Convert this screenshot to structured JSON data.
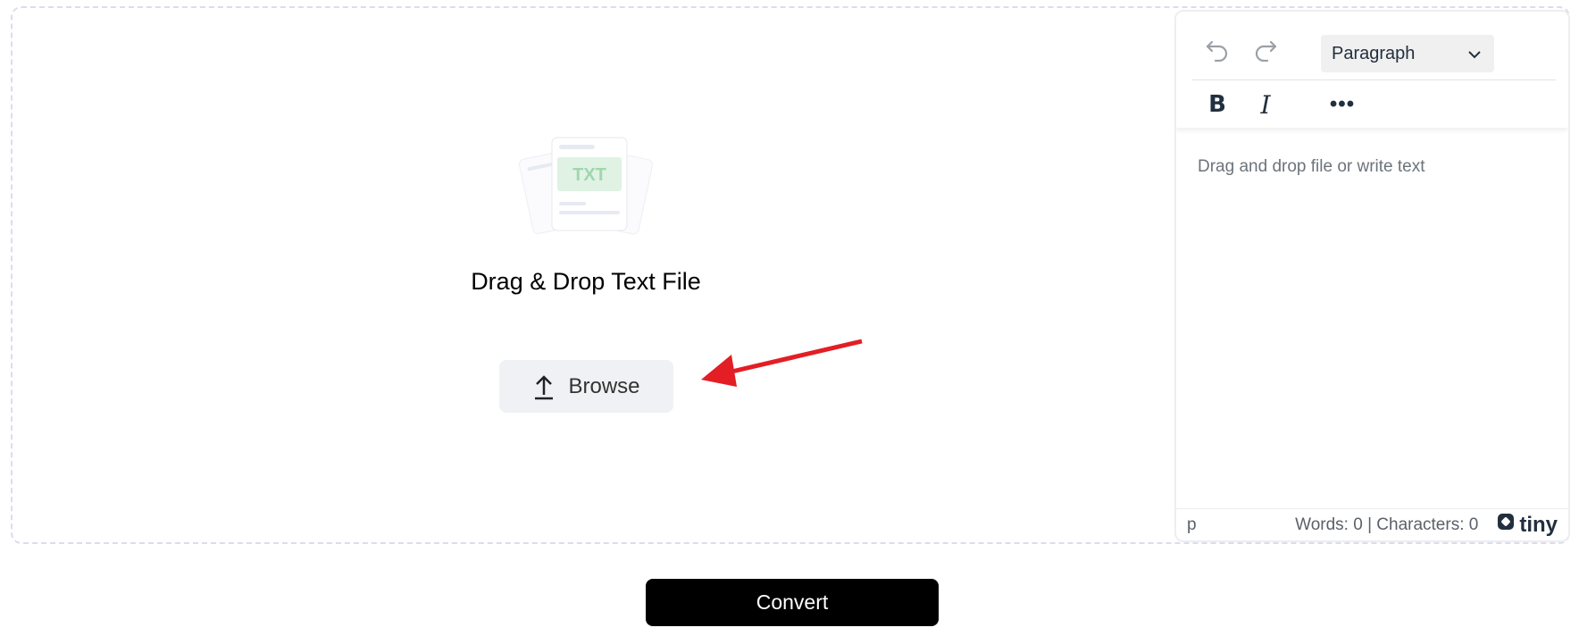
{
  "dropzone": {
    "illustration_label": "TXT",
    "title": "Drag & Drop Text File",
    "browse_label": "Browse"
  },
  "editor": {
    "block_format": "Paragraph",
    "placeholder": "Drag and drop file or write text",
    "status_path": "p",
    "word_char_count": "Words: 0 | Characters: 0",
    "brand": "tiny",
    "icons": [
      "undo-icon",
      "redo-icon",
      "chevron-down-icon",
      "bold-icon",
      "italic-icon",
      "more-icon",
      "tiny-logo-icon"
    ]
  },
  "actions": {
    "convert_label": "Convert"
  },
  "colors": {
    "accent_arrow": "#e31e24",
    "illustration_green": "#9fd7ad",
    "convert_bg": "#000000"
  }
}
